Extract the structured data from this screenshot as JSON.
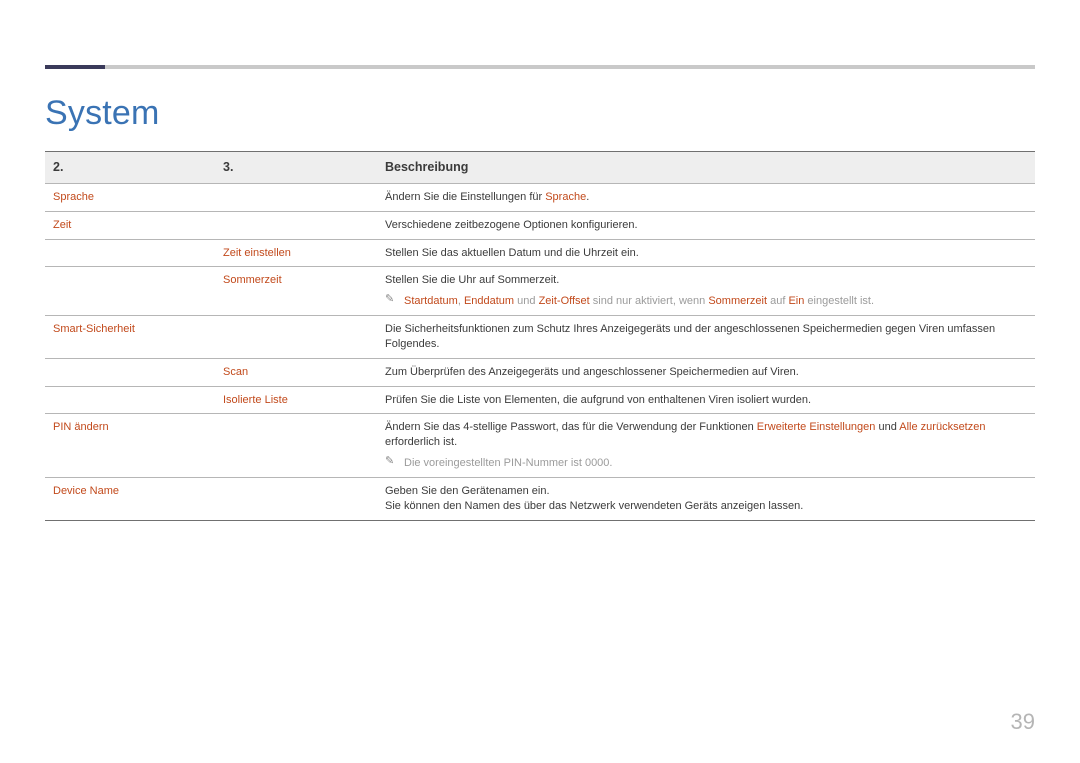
{
  "page": {
    "title": "System",
    "page_number": "39"
  },
  "table": {
    "headers": {
      "col1": "2.",
      "col2": "3.",
      "col3": "Beschreibung"
    },
    "rows": {
      "sprache": {
        "term": "Sprache",
        "desc_prefix": "Ändern Sie die Einstellungen für ",
        "desc_term": "Sprache",
        "desc_suffix": "."
      },
      "zeit": {
        "term": "Zeit",
        "desc": "Verschiedene zeitbezogene Optionen konfigurieren."
      },
      "zeit_einstellen": {
        "sub": "Zeit einstellen",
        "desc": "Stellen Sie das aktuellen Datum und die Uhrzeit ein."
      },
      "sommerzeit": {
        "sub": "Sommerzeit",
        "desc": "Stellen Sie die Uhr auf Sommerzeit.",
        "note": {
          "t1": "Startdatum",
          "sep1": ", ",
          "t2": "Enddatum",
          "mid1": " und ",
          "t3": "Zeit-Offset",
          "mid2": " sind nur aktiviert, wenn ",
          "t4": "Sommerzeit",
          "mid3": " auf ",
          "t5": "Ein",
          "end": " eingestellt ist."
        }
      },
      "smart_sicherheit": {
        "term": "Smart-Sicherheit",
        "desc": "Die Sicherheitsfunktionen zum Schutz Ihres Anzeigegeräts und der angeschlossenen Speichermedien gegen Viren umfassen Folgendes."
      },
      "scan": {
        "sub": "Scan",
        "desc": "Zum Überprüfen des Anzeigegeräts und angeschlossener Speichermedien auf Viren."
      },
      "isolierte_liste": {
        "sub": "Isolierte Liste",
        "desc": "Prüfen Sie die Liste von Elementen, die aufgrund von enthaltenen Viren isoliert wurden."
      },
      "pin_aendern": {
        "term": "PIN ändern",
        "desc_prefix": "Ändern Sie das 4-stellige Passwort, das für die Verwendung der Funktionen ",
        "t1": "Erweiterte Einstellungen",
        "mid": " und ",
        "t2": "Alle zurücksetzen",
        "suffix": " erforderlich ist.",
        "note": "Die voreingestellten PIN-Nummer ist 0000."
      },
      "device_name": {
        "term": "Device Name",
        "desc1": "Geben Sie den Gerätenamen ein.",
        "desc2": "Sie können den Namen des über das Netzwerk verwendeten Geräts anzeigen lassen."
      }
    }
  }
}
